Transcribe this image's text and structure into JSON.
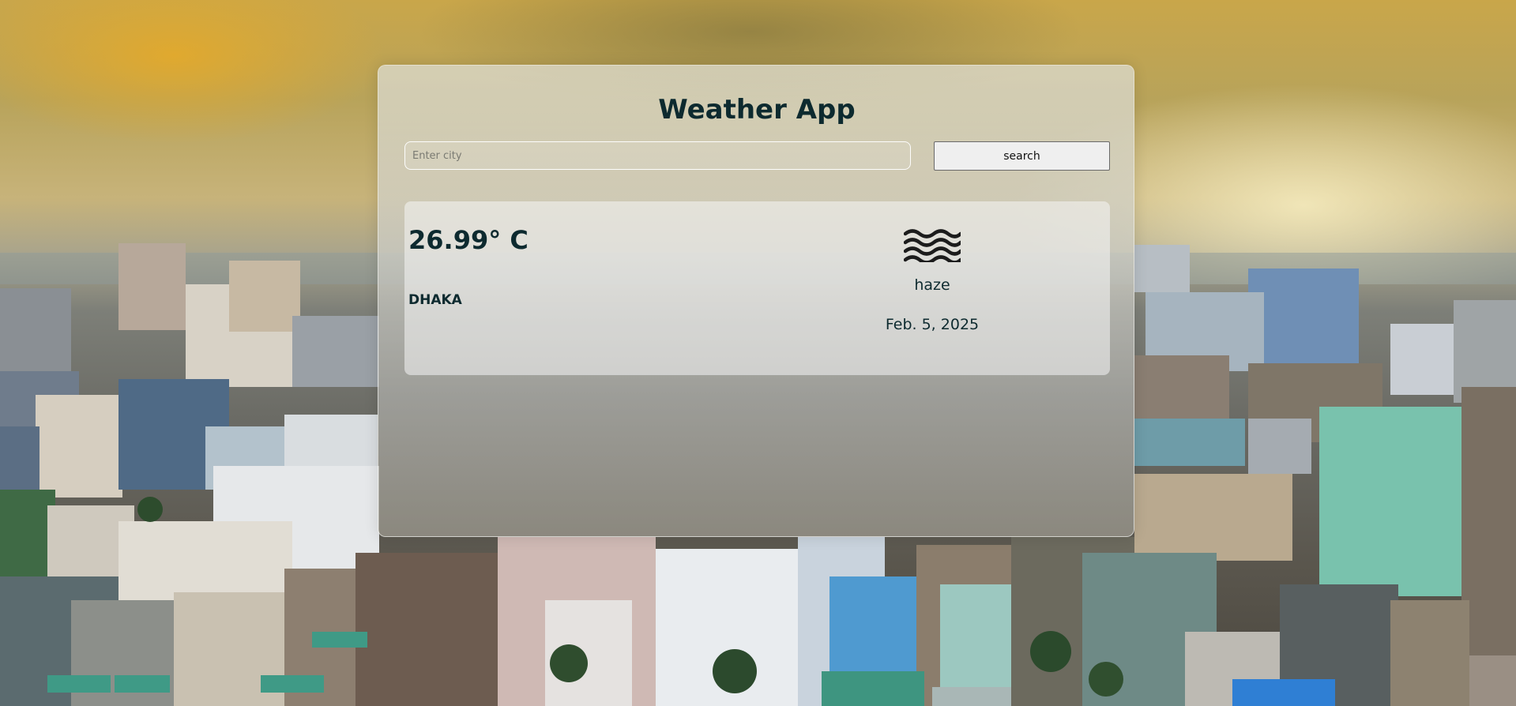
{
  "app": {
    "title": "Weather App"
  },
  "search": {
    "placeholder": "Enter city",
    "value": "",
    "button_label": "search"
  },
  "weather": {
    "temperature": "26.99° C",
    "city": "DHAKA",
    "condition": "haze",
    "condition_icon": "haze-icon",
    "date": "Feb. 5, 2025"
  },
  "colors": {
    "text_primary": "#0d2a2f",
    "button_bg": "#efefef"
  }
}
